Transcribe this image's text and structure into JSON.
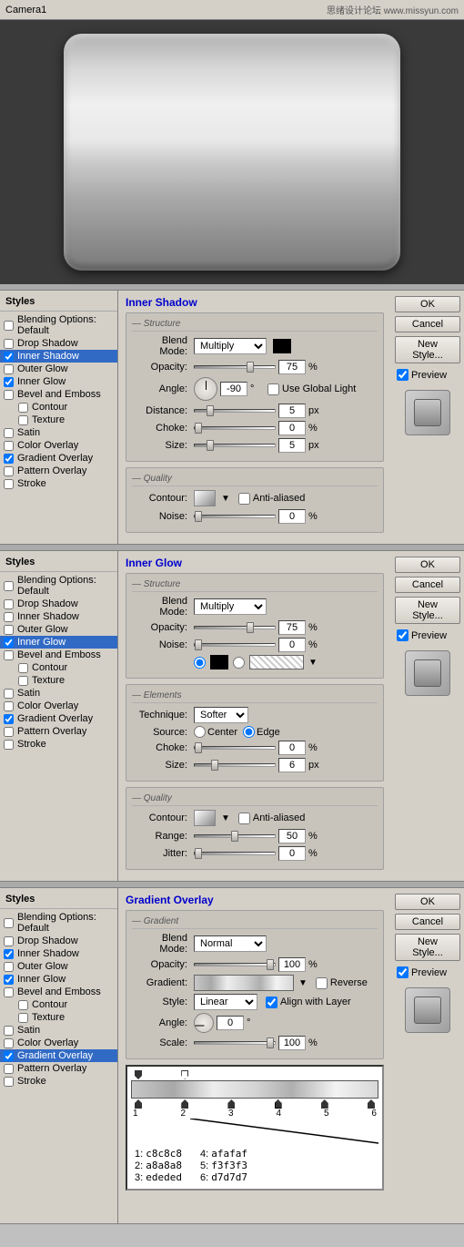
{
  "titleBar": {
    "title": "Camera1",
    "watermark": "思绪设计论坛 www.missyun.com"
  },
  "previewAlt": "Metal rectangle preview",
  "panels": [
    {
      "id": "inner-shadow",
      "sectionTitle": "Inner Shadow",
      "buttons": {
        "ok": "OK",
        "cancel": "Cancel",
        "newStyle": "New Style...",
        "preview": "Preview"
      },
      "styles": [
        {
          "label": "Blending Options: Default",
          "checked": false,
          "active": false,
          "sub": false
        },
        {
          "label": "Drop Shadow",
          "checked": false,
          "active": false,
          "sub": false
        },
        {
          "label": "Inner Shadow",
          "checked": true,
          "active": true,
          "sub": false
        },
        {
          "label": "Outer Glow",
          "checked": false,
          "active": false,
          "sub": false
        },
        {
          "label": "Inner Glow",
          "checked": true,
          "active": false,
          "sub": false
        },
        {
          "label": "Bevel and Emboss",
          "checked": false,
          "active": false,
          "sub": false
        },
        {
          "label": "Contour",
          "checked": false,
          "active": false,
          "sub": true
        },
        {
          "label": "Texture",
          "checked": false,
          "active": false,
          "sub": true
        },
        {
          "label": "Satin",
          "checked": false,
          "active": false,
          "sub": false
        },
        {
          "label": "Color Overlay",
          "checked": false,
          "active": false,
          "sub": false
        },
        {
          "label": "Gradient Overlay",
          "checked": true,
          "active": false,
          "sub": false
        },
        {
          "label": "Pattern Overlay",
          "checked": false,
          "active": false,
          "sub": false
        },
        {
          "label": "Stroke",
          "checked": false,
          "active": false,
          "sub": false
        }
      ],
      "structure": {
        "title": "Structure",
        "blendMode": {
          "label": "Blend Mode:",
          "value": "Multiply"
        },
        "opacity": {
          "label": "Opacity:",
          "value": "75",
          "unit": "%",
          "sliderPos": 75
        },
        "angle": {
          "label": "Angle:",
          "value": "-90",
          "unit": "°",
          "useGlobalLight": false,
          "useGlobalLightLabel": "Use Global Light"
        },
        "distance": {
          "label": "Distance:",
          "value": "5",
          "unit": "px",
          "sliderPos": 20
        },
        "choke": {
          "label": "Choke:",
          "value": "0",
          "unit": "%",
          "sliderPos": 0
        },
        "size": {
          "label": "Size:",
          "value": "5",
          "unit": "px",
          "sliderPos": 20
        }
      },
      "quality": {
        "title": "Quality",
        "contour": {
          "label": "Contour:",
          "antiAliased": false,
          "antiAliasedLabel": "Anti-aliased"
        },
        "noise": {
          "label": "Noise:",
          "value": "0",
          "unit": "%",
          "sliderPos": 0
        }
      }
    },
    {
      "id": "inner-glow",
      "sectionTitle": "Inner Glow",
      "buttons": {
        "ok": "OK",
        "cancel": "Cancel",
        "newStyle": "New Style...",
        "preview": "Preview"
      },
      "styles": [
        {
          "label": "Blending Options: Default",
          "checked": false,
          "active": false,
          "sub": false
        },
        {
          "label": "Drop Shadow",
          "checked": false,
          "active": false,
          "sub": false
        },
        {
          "label": "Inner Shadow",
          "checked": false,
          "active": false,
          "sub": false
        },
        {
          "label": "Outer Glow",
          "checked": false,
          "active": false,
          "sub": false
        },
        {
          "label": "Inner Glow",
          "checked": true,
          "active": true,
          "sub": false
        },
        {
          "label": "Bevel and Emboss",
          "checked": false,
          "active": false,
          "sub": false
        },
        {
          "label": "Contour",
          "checked": false,
          "active": false,
          "sub": true
        },
        {
          "label": "Texture",
          "checked": false,
          "active": false,
          "sub": true
        },
        {
          "label": "Satin",
          "checked": false,
          "active": false,
          "sub": false
        },
        {
          "label": "Color Overlay",
          "checked": false,
          "active": false,
          "sub": false
        },
        {
          "label": "Gradient Overlay",
          "checked": true,
          "active": false,
          "sub": false
        },
        {
          "label": "Pattern Overlay",
          "checked": false,
          "active": false,
          "sub": false
        },
        {
          "label": "Stroke",
          "checked": false,
          "active": false,
          "sub": false
        }
      ],
      "structure": {
        "title": "Structure",
        "blendMode": {
          "label": "Blend Mode:",
          "value": "Multiply"
        },
        "opacity": {
          "label": "Opacity:",
          "value": "75",
          "unit": "%"
        },
        "noise": {
          "label": "Noise:",
          "value": "0",
          "unit": "%"
        }
      },
      "elements": {
        "title": "Elements",
        "technique": {
          "label": "Technique:",
          "value": "Softer"
        },
        "source": {
          "label": "Source:",
          "center": "Center",
          "edge": "Edge",
          "selected": "Edge"
        },
        "choke": {
          "label": "Choke:",
          "value": "0",
          "unit": "%"
        },
        "size": {
          "label": "Size:",
          "value": "6",
          "unit": "px"
        }
      },
      "quality": {
        "title": "Quality",
        "contour": {
          "label": "Contour:",
          "antiAliased": false
        },
        "range": {
          "label": "Range:",
          "value": "50",
          "unit": "%"
        },
        "jitter": {
          "label": "Jitter:",
          "value": "0",
          "unit": "%"
        }
      }
    },
    {
      "id": "gradient-overlay",
      "sectionTitle": "Gradient Overlay",
      "buttons": {
        "ok": "OK",
        "cancel": "Cancel",
        "newStyle": "New Style...",
        "preview": "Preview"
      },
      "styles": [
        {
          "label": "Blending Options: Default",
          "checked": false,
          "active": false,
          "sub": false
        },
        {
          "label": "Drop Shadow",
          "checked": false,
          "active": false,
          "sub": false
        },
        {
          "label": "Inner Shadow",
          "checked": true,
          "active": false,
          "sub": false
        },
        {
          "label": "Outer Glow",
          "checked": false,
          "active": false,
          "sub": false
        },
        {
          "label": "Inner Glow",
          "checked": true,
          "active": false,
          "sub": false
        },
        {
          "label": "Bevel and Emboss",
          "checked": false,
          "active": false,
          "sub": false
        },
        {
          "label": "Contour",
          "checked": false,
          "active": false,
          "sub": true
        },
        {
          "label": "Texture",
          "checked": false,
          "active": false,
          "sub": true
        },
        {
          "label": "Satin",
          "checked": false,
          "active": false,
          "sub": false
        },
        {
          "label": "Color Overlay",
          "checked": false,
          "active": false,
          "sub": false
        },
        {
          "label": "Gradient Overlay",
          "checked": true,
          "active": true,
          "sub": false
        },
        {
          "label": "Pattern Overlay",
          "checked": false,
          "active": false,
          "sub": false
        },
        {
          "label": "Stroke",
          "checked": false,
          "active": false,
          "sub": false
        }
      ],
      "gradient": {
        "title": "Gradient",
        "blendMode": {
          "label": "Blend Mode:",
          "value": "Normal"
        },
        "opacity": {
          "label": "Opacity:",
          "value": "100",
          "unit": "%"
        },
        "gradientLabel": "Gradient:",
        "reverse": "Reverse",
        "style": {
          "label": "Style:",
          "value": "Linear"
        },
        "alignWithLayer": "Align with Layer",
        "angle": {
          "label": "Angle:",
          "value": "0",
          "unit": "°"
        },
        "scale": {
          "label": "Scale:",
          "value": "100",
          "unit": "%"
        }
      },
      "gradientStops": {
        "stops": [
          {
            "pos": 0,
            "label": "1"
          },
          {
            "pos": 17,
            "label": "2"
          },
          {
            "pos": 33,
            "label": "3"
          },
          {
            "pos": 50,
            "label": "4"
          },
          {
            "pos": 67,
            "label": "5"
          },
          {
            "pos": 83,
            "label": "6"
          }
        ],
        "colors": [
          {
            "num": "1",
            "hex": "c8c8c8"
          },
          {
            "num": "2",
            "hex": "a8a8a8"
          },
          {
            "num": "3",
            "hex": "ededed"
          },
          {
            "num": "4",
            "hex": "afafaf"
          },
          {
            "num": "5",
            "hex": "f3f3f3"
          },
          {
            "num": "6",
            "hex": "d7d7d7"
          }
        ]
      }
    }
  ]
}
